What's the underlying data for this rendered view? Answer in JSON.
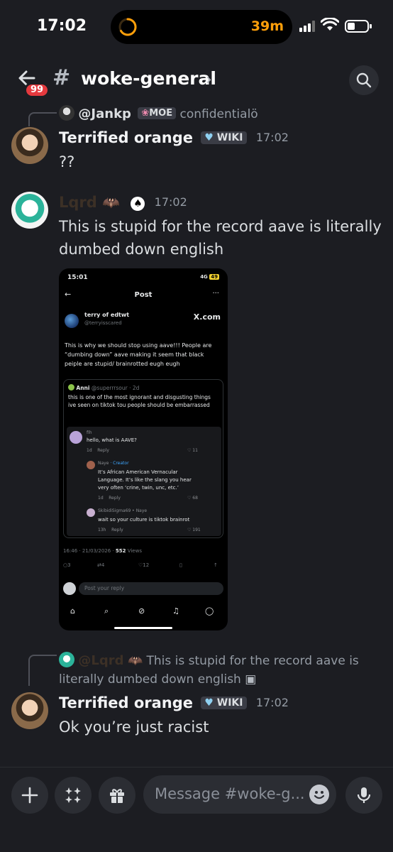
{
  "status_bar": {
    "time": "17:02",
    "island_time": "39m"
  },
  "header": {
    "unread_count": "99",
    "hash": "#",
    "channel_name": "woke-general",
    "chevron": "›"
  },
  "messages": [
    {
      "reply_to": {
        "author": "@Jankp",
        "tag": "MOE",
        "tag_icon": "flower-icon",
        "preview": "confidentialö"
      },
      "author": "Terrified orange",
      "tag": "WIKI",
      "tag_icon": "heart-icon",
      "timestamp": "17:02",
      "text": "??"
    },
    {
      "author": "Lqrd",
      "author_color": "#3c3026",
      "timestamp": "17:02",
      "text": "This is stupid for the record aave is literally dumbed down english"
    },
    {
      "reply_to": {
        "author": "@Lqrd",
        "preview": "This is stupid for the record aave is literally dumbed down english"
      },
      "author": "Terrified orange",
      "tag": "WIKI",
      "timestamp": "17:02",
      "text": "Ok you’re just racist"
    }
  ],
  "embed": {
    "status_time": "15:01",
    "status_indicators": "4G",
    "battery": "49",
    "header_title": "Post",
    "post": {
      "display_name": "terry of edtwt",
      "handle": "@terryisscared",
      "site": "X.com",
      "body": "This is why we should stop using aave!!! People are “dumbing down” aave making it seem that black peiple are stupid/ brainrotted eugh eugh"
    },
    "quote": {
      "name": "Anni",
      "handle": "@superrrsour",
      "age": "2d",
      "body": "this is one of the most ignorant and disgusting things ive seen on tiktok tou people should be embarrassed"
    },
    "tiktok_comments": [
      {
        "user": "fih",
        "text": "hello, what is AAVE?",
        "meta": "1d",
        "reply": "Reply",
        "likes": "11"
      },
      {
        "user": "Naye",
        "badge": "· Creator",
        "text1": "It’s African American Vernacular",
        "text2": "Language. It’s like the slang you hear",
        "text3": "very often ‘crine, twin, unc, etc.’",
        "meta": "1d",
        "reply": "Reply",
        "likes": "68"
      },
      {
        "user": "SkibidiSigma69 ‣ Naye",
        "text": "wait so your culture is tiktok brainrot",
        "meta": "13h",
        "reply": "Reply",
        "likes": "191"
      }
    ],
    "timestamp_line": "16:46 · 21/03/2026 · ",
    "views_count": "552",
    "views_label": " Views",
    "actions": {
      "replies": "3",
      "reposts": "4",
      "likes": "12"
    },
    "reply_placeholder": "Post your reply"
  },
  "composer": {
    "placeholder": "Message #woke-g..."
  },
  "colors": {
    "background": "#1c1d22",
    "badge_red": "#e5393e",
    "island_orange": "#ff9f0a"
  }
}
